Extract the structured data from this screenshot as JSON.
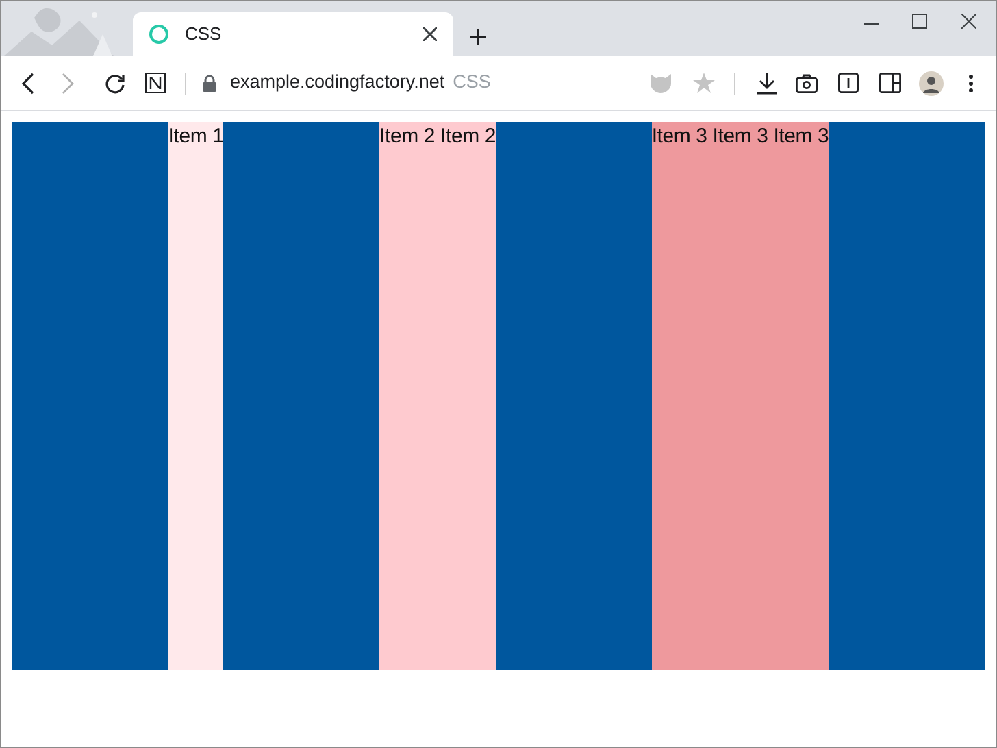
{
  "tab": {
    "title": "CSS",
    "selected": true
  },
  "address_bar": {
    "url": "example.codingfactory.net",
    "page_title": "CSS"
  },
  "flex_items": [
    {
      "text": "Item 1",
      "color": "#ffe9eb"
    },
    {
      "text": "Item 2 Item 2",
      "color": "#fecacf"
    },
    {
      "text": "Item 3 Item 3 Item 3",
      "color": "#ee999d"
    }
  ]
}
